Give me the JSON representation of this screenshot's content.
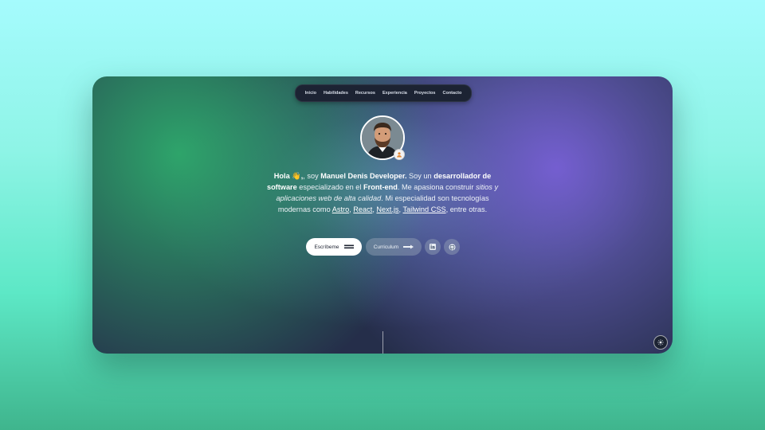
{
  "nav": {
    "items": [
      "Inicio",
      "Habilidades",
      "Recursos",
      "Experiencia",
      "Proyectos",
      "Contacto"
    ]
  },
  "bio": {
    "greeting": "Hola",
    "wave": "👋",
    "t1": ", soy ",
    "name": "Manuel Denis Developer.",
    "t2": " Soy un ",
    "role": "desarrollador de software",
    "t3": " especializado en el ",
    "area": "Front-end",
    "t4": ". Me apasiona construir ",
    "focus": "sitios y aplicaciones web de alta calidad",
    "t5": ". Mi especialidad son tecnologías modernas como ",
    "tech": [
      "Astro",
      "React",
      "Next.js",
      "Tailwind CSS"
    ],
    "sep": ", ",
    "t6": ", entre otras."
  },
  "actions": {
    "contact_label": "Escríbeme",
    "cv_label": "Curriculum"
  },
  "icons": {
    "linkedin": "linkedin-icon",
    "github": "github-icon",
    "theme": "theme-toggle-icon"
  },
  "colors": {
    "accent_green": "#2eaa6c",
    "accent_purple": "#7860d6",
    "card_base": "#252e4a"
  }
}
